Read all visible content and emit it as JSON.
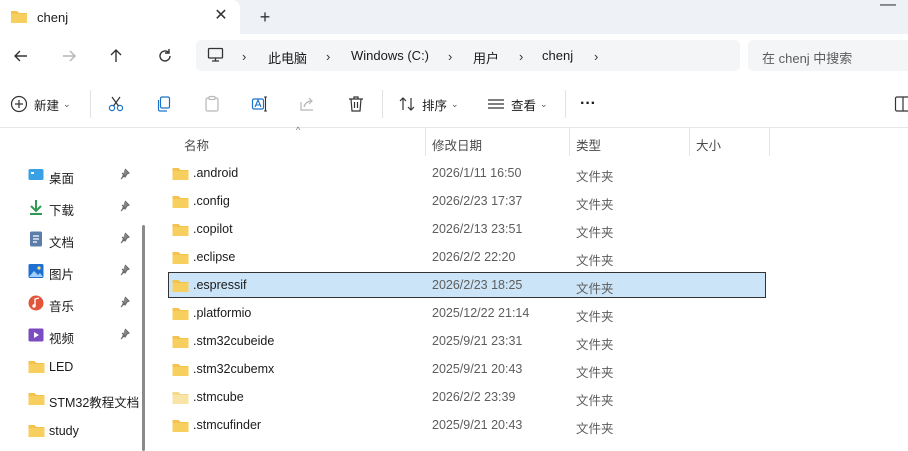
{
  "window": {
    "tab_title": "chenj",
    "new_tab": "+",
    "close_tab": "✕",
    "minimize": "—"
  },
  "address": {
    "segments": [
      "此电脑",
      "Windows (C:)",
      "用户",
      "chenj"
    ],
    "separator": "›"
  },
  "search": {
    "placeholder": "在 chenj 中搜索"
  },
  "toolbar": {
    "new_label": "新建",
    "sort_label": "排序",
    "view_label": "查看",
    "more_label": "···"
  },
  "sidebar": {
    "items": [
      {
        "label": "桌面",
        "icon": "desktop-icon",
        "pinned": true
      },
      {
        "label": "下载",
        "icon": "download-icon",
        "pinned": true
      },
      {
        "label": "文档",
        "icon": "document-icon",
        "pinned": true
      },
      {
        "label": "图片",
        "icon": "pictures-icon",
        "pinned": true
      },
      {
        "label": "音乐",
        "icon": "music-icon",
        "pinned": true
      },
      {
        "label": "视频",
        "icon": "video-icon",
        "pinned": true
      },
      {
        "label": "LED",
        "icon": "folder-icon",
        "pinned": false
      },
      {
        "label": "STM32教程文档",
        "icon": "folder-icon",
        "pinned": false
      },
      {
        "label": "study",
        "icon": "folder-icon",
        "pinned": false
      }
    ]
  },
  "columns": {
    "name": "名称",
    "date": "修改日期",
    "type": "类型",
    "size": "大小"
  },
  "files": [
    {
      "name": ".android",
      "date": "2026/1/11 16:50",
      "type": "文件夹",
      "selected": false
    },
    {
      "name": ".config",
      "date": "2026/2/23 17:37",
      "type": "文件夹",
      "selected": false
    },
    {
      "name": ".copilot",
      "date": "2026/2/13 23:51",
      "type": "文件夹",
      "selected": false
    },
    {
      "name": ".eclipse",
      "date": "2026/2/2 22:20",
      "type": "文件夹",
      "selected": false
    },
    {
      "name": ".espressif",
      "date": "2026/2/23 18:25",
      "type": "文件夹",
      "selected": true
    },
    {
      "name": ".platformio",
      "date": "2025/12/22 21:14",
      "type": "文件夹",
      "selected": false
    },
    {
      "name": ".stm32cubeide",
      "date": "2025/9/21 23:31",
      "type": "文件夹",
      "selected": false
    },
    {
      "name": ".stm32cubemx",
      "date": "2025/9/21 20:43",
      "type": "文件夹",
      "selected": false
    },
    {
      "name": ".stmcube",
      "date": "2026/2/2 23:39",
      "type": "文件夹",
      "selected": false
    },
    {
      "name": ".stmcufinder",
      "date": "2025/9/21 20:43",
      "type": "文件夹",
      "selected": false
    }
  ],
  "colors": {
    "selection_bg": "#cce4f7",
    "folder": "#f3c24f",
    "folder_light": "#f7dc8a",
    "titlebar_bg": "#eef1f6"
  }
}
